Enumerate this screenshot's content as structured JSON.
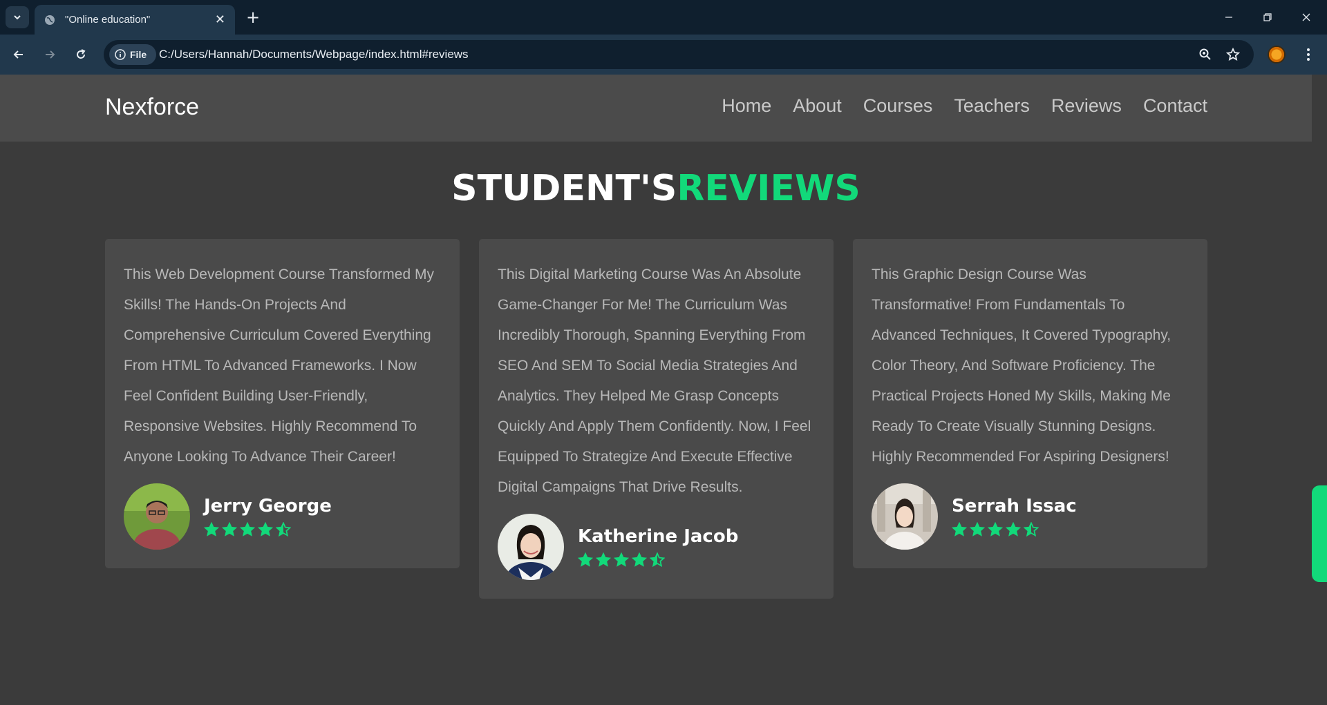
{
  "browser": {
    "tab_title": "\"Online education\"",
    "tab_close": "✕",
    "new_tab": "+",
    "security_chip": "File",
    "url": "C:/Users/Hannah/Documents/Webpage/index.html#reviews"
  },
  "site": {
    "logo": "Nexforce",
    "nav": [
      "Home",
      "About",
      "Courses",
      "Teachers",
      "Reviews",
      "Contact"
    ]
  },
  "section": {
    "title_white": "STUDENT'S",
    "title_green": "REVIEWS"
  },
  "reviews": [
    {
      "text": "This Web Development Course Transformed My Skills! The Hands-On Projects And Comprehensive Curriculum Covered Everything From HTML To Advanced Frameworks. I Now Feel Confident Building User-Friendly, Responsive Websites. Highly Recommend To Anyone Looking To Advance Their Career!",
      "name": "Jerry George",
      "rating": 4.5
    },
    {
      "text": "This Digital Marketing Course Was An Absolute Game-Changer For Me! The Curriculum Was Incredibly Thorough, Spanning Everything From SEO And SEM To Social Media Strategies And Analytics. They Helped Me Grasp Concepts Quickly And Apply Them Confidently. Now, I Feel Equipped To Strategize And Execute Effective Digital Campaigns That Drive Results.",
      "name": "Katherine Jacob",
      "rating": 4.5
    },
    {
      "text": "This Graphic Design Course Was Transformative! From Fundamentals To Advanced Techniques, It Covered Typography, Color Theory, And Software Proficiency. The Practical Projects Honed My Skills, Making Me Ready To Create Visually Stunning Designs. Highly Recommended For Aspiring Designers!",
      "name": "Serrah Issac",
      "rating": 4.5
    }
  ],
  "colors": {
    "accent": "#12d97a",
    "page_bg": "#3b3b3b",
    "card_bg": "#4a4a4a",
    "header_bg": "#4b4b4b"
  }
}
